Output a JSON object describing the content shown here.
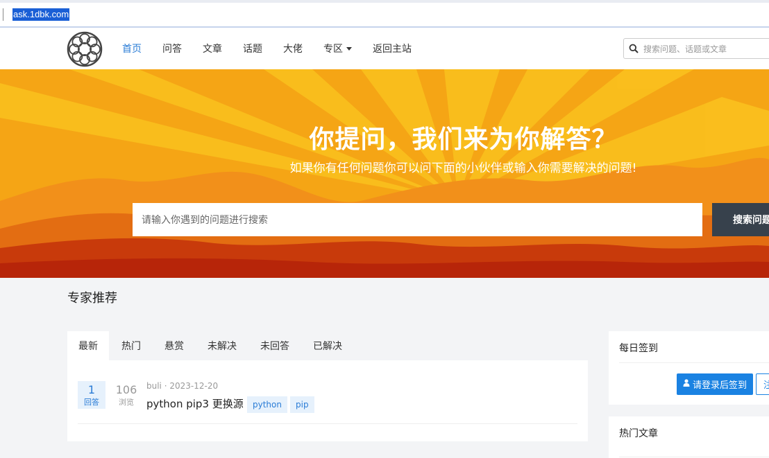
{
  "browser": {
    "url": "ask.1dbk.com"
  },
  "nav": {
    "items": [
      {
        "label": "首页",
        "active": true
      },
      {
        "label": "问答"
      },
      {
        "label": "文章"
      },
      {
        "label": "话题"
      },
      {
        "label": "大佬"
      },
      {
        "label": "专区",
        "dropdown": true
      },
      {
        "label": "返回主站"
      }
    ],
    "search_placeholder": "搜索问题、话题或文章"
  },
  "banner": {
    "title": "你提问，我们来为你解答？",
    "subtitle": "如果你有任何问题你可以问下面的小伙伴或输入你需要解决的问题!",
    "search_placeholder": "请输入你遇到的问题进行搜索",
    "search_button": "搜索问题"
  },
  "main": {
    "section_title": "专家推荐",
    "tabs": [
      {
        "label": "最新",
        "active": true
      },
      {
        "label": "热门"
      },
      {
        "label": "悬赏"
      },
      {
        "label": "未解决"
      },
      {
        "label": "未回答"
      },
      {
        "label": "已解决"
      }
    ],
    "questions": [
      {
        "answers": "1",
        "answers_label": "回答",
        "views": "106",
        "views_label": "浏览",
        "author": "buli",
        "date": "2023-12-20",
        "title": "python pip3 更换源",
        "tags": [
          "python",
          "pip"
        ]
      }
    ]
  },
  "sidebar": {
    "checkin_title": "每日签到",
    "login_button": "请登录后签到",
    "register_button": "注",
    "hot_articles_title": "热门文章"
  },
  "colors": {
    "accent": "#2a7cd6",
    "banner": "#f4a417",
    "button_dark": "#37414c",
    "primary_button": "#1a82e2"
  }
}
